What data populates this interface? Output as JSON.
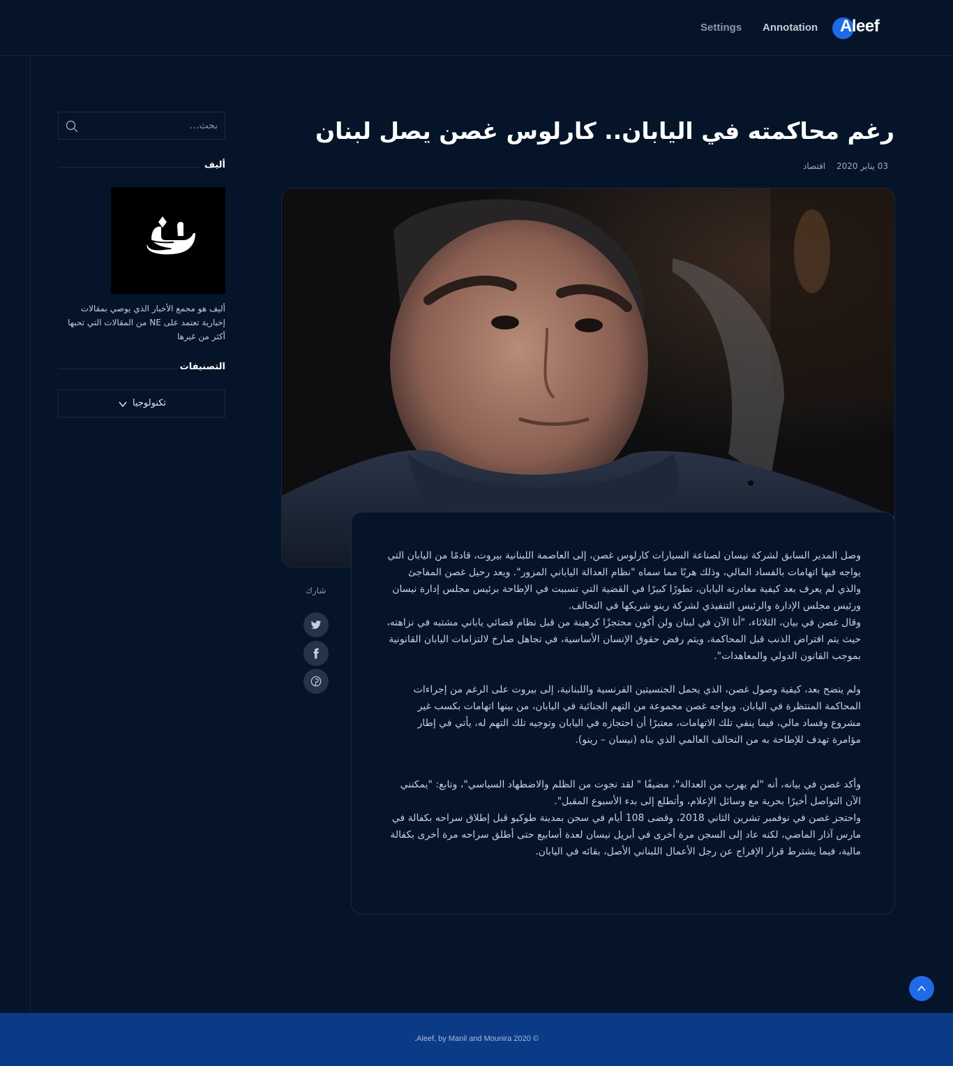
{
  "header": {
    "nav": [
      {
        "label": "Settings"
      },
      {
        "label": "Annotation"
      }
    ],
    "logo_text": "Aleef",
    "colors": {
      "background": "#061429",
      "accent": "#1f6ae6"
    }
  },
  "sidebar": {
    "search": {
      "placeholder": "بحث…",
      "icon": "search-icon"
    },
    "about": {
      "title": "أليف",
      "logo_icon": "aleef-calligraphy-logo",
      "text": "أليف هو مجمع الأخبار الذي يوصي بمقالات إخبارية تعتمد على NE من المقالات التي تحبها أكثر من غيرها"
    },
    "categories": {
      "title": "التصنيفات",
      "selected": "تكنولوجيا",
      "icon": "chevron-down-icon"
    }
  },
  "article": {
    "title": "رغم محاكمته في اليابان.. كارلوس غصن يصل لبنان",
    "date": "03 يناير 2020",
    "category": "اقتصاد",
    "paragraphs": [
      "وصل المدير السابق لشركة نيسان لصناعة السيارات كارلوس غصن، إلى العاصمة اللبنانية بيروت، قادمًا من اليابان التي يواجه فيها اتهامات بالفساد المالي، وذلك هربًا مما سماه \"نظام العدالة الياباني المزور\". ويعد رحيل غصن المفاجئ والذي لم يعرف بعد كيفية مغادرته اليابان، تطورًا كبيرًا في القضية التي تسببت في الإطاحة برئيس مجلس إدارة نيسان ورئيس مجلس الإدارة والرئيس التنفيذي لشركة رينو شريكها في التحالف.\nوقال غصن في بيان، الثلاثاء، \"أنا الآن في لبنان ولن أكون محتجزًا كرهينة من قبل نظام قضائي ياباني مشتبه في نزاهته، حيث يتم افتراض الذنب قبل المحاكمة، ويتم رفض حقوق الإنسان الأساسية، في تجاهل صارخ لالتزامات اليابان القانونية بموجب القانون الدولي والمعاهدات\".",
      "ولم يتضح بعد، كيفية وصول غصن، الذي يحمل الجنسيتين الفرنسية واللبنانية، إلى بيروت على الرغم من إجراءات المحاكمة المنتظرة في اليابان. ويواجه غصن مجموعة من التهم الجنائية في اليابان، من بينها اتهامات بكسب غير مشروع وفساد مالي، فيما ينفي تلك الاتهامات، معتبرًا أن احتجازه في اليابان وتوجيه تلك التهم له، يأتي في إطار مؤامرة تهدف للإطاحة به من التحالف العالمي الذي بناه (نيسان – رينو).",
      "وأكد غصن في بيانه، أنه \"لم يهرب من العدالة\"، مضيفًا \" لقد نجوت من الظلم والاضطهاد السياسي\"، وتابع: \"يمكنني الآن التواصل أخيرًا بحرية مع وسائل الإعلام، وأتطلع إلى بدء الأسبوع المقبل\".\nواحتجز غصن في نوفمبر تشرين الثاني 2018، وقضى 108 أيام في سجن بمدينة طوكيو قبل إطلاق سراحه بكفالة في مارس آذار الماضي، لكنه عاد إلى السجن مرة أخرى في أبريل نيسان لعدة أسابيع حتى أطلق سراحه مرة أخرى بكفالة مالية، فيما يشترط قرار الإفراج عن رجل الأعمال اللبناني الأصل، بقائه في اليابان."
    ],
    "share": {
      "label": "شارك",
      "buttons": [
        "twitter-icon",
        "facebook-icon",
        "pinterest-icon"
      ]
    }
  },
  "footer": {
    "copyright": ".Aleef, by Manil and Mounira 2020 ©"
  }
}
